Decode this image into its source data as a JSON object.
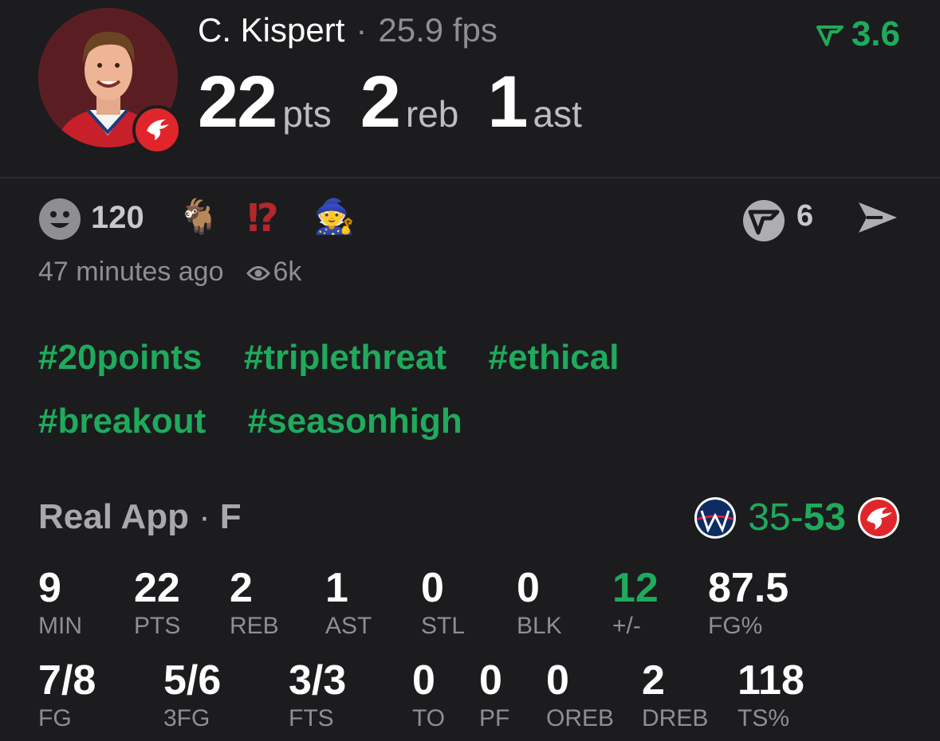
{
  "player": {
    "name": "C. Kispert",
    "fantasy": "25.9 fps",
    "pts": "22",
    "pts_label": "pts",
    "reb": "2",
    "reb_label": "reb",
    "ast": "1",
    "ast_label": "ast",
    "score": "3.6",
    "team_badge_icon": "hawks-logo-icon"
  },
  "reactions": {
    "count": "120",
    "emojis": [
      "🐐",
      "⁉",
      "🧙"
    ],
    "comments": "6"
  },
  "meta": {
    "time": "47 minutes ago",
    "views": "6k"
  },
  "hashtags": [
    "#20points",
    "#triplethreat",
    "#ethical",
    "#breakout",
    "#seasonhigh"
  ],
  "game": {
    "app": "Real App",
    "status": "F",
    "score_left": "35",
    "score_sep": "-",
    "score_right": "53",
    "left_team_icon": "wizards-logo-icon",
    "right_team_icon": "hawks-logo-icon"
  },
  "stats_row1": [
    {
      "value": "9",
      "label": "MIN"
    },
    {
      "value": "22",
      "label": "PTS"
    },
    {
      "value": "2",
      "label": "REB"
    },
    {
      "value": "1",
      "label": "AST"
    },
    {
      "value": "0",
      "label": "STL"
    },
    {
      "value": "0",
      "label": "BLK"
    },
    {
      "value": "12",
      "label": "+/-"
    },
    {
      "value": "87.5",
      "label": "FG%"
    }
  ],
  "stats_row2": [
    {
      "value": "7/8",
      "label": "FG"
    },
    {
      "value": "5/6",
      "label": "3FG"
    },
    {
      "value": "3/3",
      "label": "FTS"
    },
    {
      "value": "0",
      "label": "TO"
    },
    {
      "value": "0",
      "label": "PF"
    },
    {
      "value": "0",
      "label": "OREB"
    },
    {
      "value": "2",
      "label": "DREB"
    },
    {
      "value": "118",
      "label": "TS%"
    }
  ],
  "colors": {
    "accent": "#1faa5c",
    "background": "#1c1c1e",
    "muted": "#8e8e93"
  }
}
